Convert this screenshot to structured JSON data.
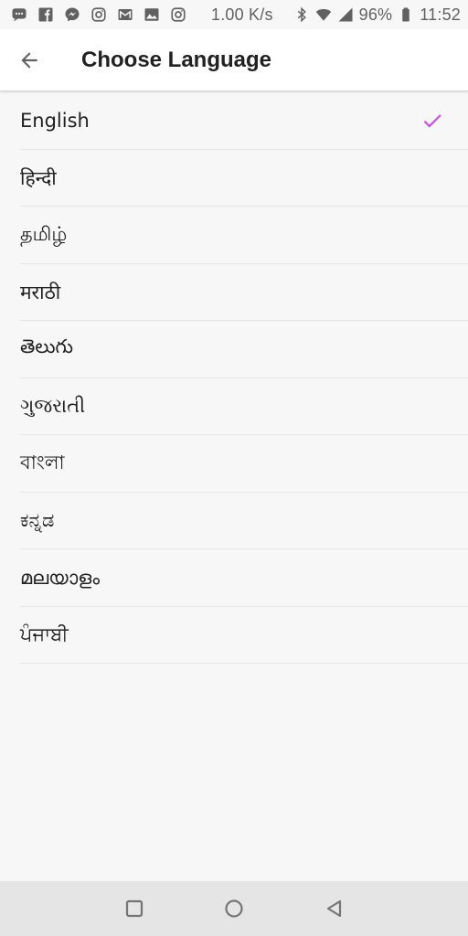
{
  "status_bar": {
    "net_speed": "1.00 K/s",
    "battery": "96%",
    "time": "11:52",
    "icons": [
      "chat-icon",
      "facebook-icon",
      "messenger-icon",
      "instagram-icon",
      "gmail-icon",
      "gallery-icon",
      "instagram-icon",
      "bluetooth-icon",
      "wifi-icon",
      "signal-icon",
      "battery-icon"
    ]
  },
  "app_bar": {
    "title": "Choose Language",
    "back_icon": "arrow-left-icon"
  },
  "languages": [
    {
      "label": "English",
      "selected": true
    },
    {
      "label": "हिन्दी",
      "selected": false
    },
    {
      "label": "தமிழ்",
      "selected": false
    },
    {
      "label": "मराठी",
      "selected": false
    },
    {
      "label": "తెలుగు",
      "selected": false
    },
    {
      "label": "ગુજરાતી",
      "selected": false
    },
    {
      "label": "বাংলা",
      "selected": false
    },
    {
      "label": "ಕನ್ನಡ",
      "selected": false
    },
    {
      "label": "മലയാളം",
      "selected": false
    },
    {
      "label": "ਪੰਜਾਬੀ",
      "selected": false
    }
  ],
  "colors": {
    "accent": "#c94ee6",
    "background": "#f7f7f7",
    "app_bar": "#ffffff",
    "nav_bar": "#e5e5e5"
  },
  "nav_bar": {
    "buttons": [
      "recents-square-icon",
      "home-circle-icon",
      "back-triangle-icon"
    ]
  }
}
